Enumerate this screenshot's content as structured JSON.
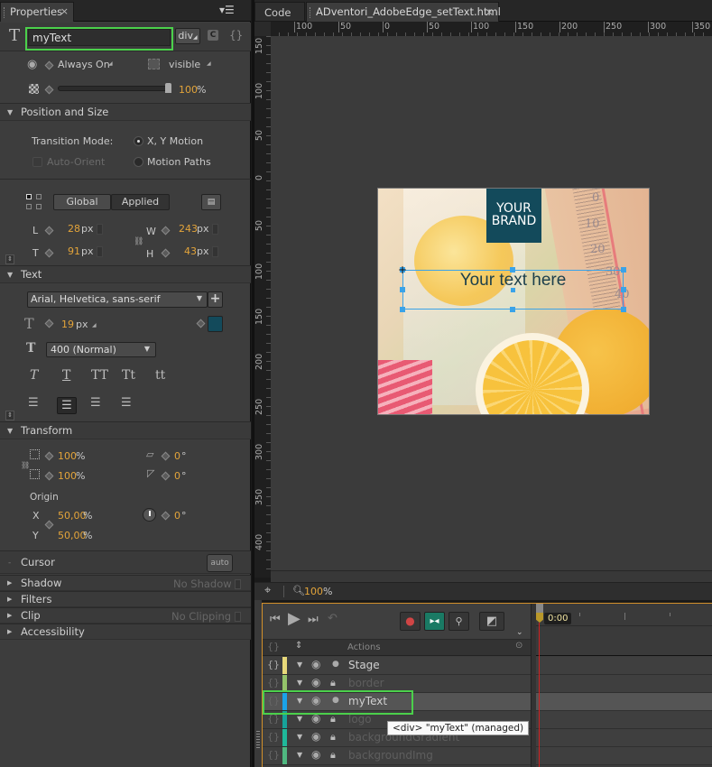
{
  "properties_panel": {
    "tab_label": "Properties",
    "element_name": "myText",
    "tag": "div",
    "display_mode": "Always On",
    "visibility": "visible",
    "opacity_value": "100",
    "opacity_unit": "%",
    "opacity_fraction": 1.0,
    "position_size": {
      "header": "Position and Size",
      "transition_mode_label": "Transition Mode:",
      "option_xy": "X, Y Motion",
      "option_paths": "Motion Paths",
      "auto_orient": "Auto-Orient",
      "global_label": "Global",
      "applied_label": "Applied",
      "L_label": "L",
      "L_value": "28",
      "L_unit": "px",
      "T_label": "T",
      "T_value": "91",
      "T_unit": "px",
      "W_label": "W",
      "W_value": "243",
      "W_unit": "px",
      "H_label": "H",
      "H_value": "43",
      "H_unit": "px"
    },
    "text": {
      "header": "Text",
      "font_family": "Arial, Helvetica, sans-serif",
      "font_size": "19",
      "font_size_unit": "px",
      "font_color": "#134a5b",
      "font_weight": "400 (Normal)",
      "style_buttons": [
        "T",
        "T",
        "TT",
        "Tt",
        "tt"
      ]
    },
    "transform": {
      "header": "Transform",
      "scale_x": "100",
      "scale_x_unit": "%",
      "scale_y": "100",
      "scale_y_unit": "%",
      "skew_x": "0",
      "skew_y": "0",
      "deg": "°",
      "origin_label": "Origin",
      "origin_x_label": "X",
      "origin_x": "50,00",
      "origin_x_unit": "%",
      "origin_y_label": "Y",
      "origin_y": "50,00",
      "origin_y_unit": "%",
      "rotation": "0"
    },
    "cursor": {
      "label": "Cursor",
      "value": "auto"
    },
    "shadow": {
      "label": "Shadow",
      "value": "No Shadow"
    },
    "filters": {
      "label": "Filters"
    },
    "clip": {
      "label": "Clip",
      "value": "No Clipping"
    },
    "accessibility": {
      "label": "Accessibility"
    }
  },
  "editor": {
    "tabs": [
      {
        "label": "Code"
      },
      {
        "label": "ADventori_AdobeEdge_setText.html",
        "active": true
      }
    ],
    "h_ruler": [
      "100",
      "50",
      "0",
      "50",
      "100",
      "150",
      "200",
      "250",
      "300",
      "350"
    ],
    "v_ruler": [
      "150",
      "100",
      "50",
      "0",
      "50",
      "100",
      "150",
      "200",
      "250",
      "300",
      "350",
      "400"
    ],
    "zoom_value": "100",
    "zoom_unit": "%",
    "stage": {
      "brand_line1": "YOUR",
      "brand_line2": "BRAND",
      "brand_bg": "#134a5b",
      "text_content": "Your text here",
      "thermometer_numbers": [
        "0",
        "10",
        "20",
        "30",
        "40"
      ]
    }
  },
  "timeline": {
    "time": "0:00",
    "actions_label": "Actions",
    "layers": [
      {
        "name": "Stage",
        "color": "#e8d97a",
        "locked": false,
        "dim": false
      },
      {
        "name": "border",
        "color": "#94c36a",
        "locked": true,
        "dim": true
      },
      {
        "name": "myText",
        "color": "#1aa3e8",
        "locked": false,
        "dim": false,
        "selected": true
      },
      {
        "name": "logo",
        "color": "#16a39a",
        "locked": true,
        "dim": true
      },
      {
        "name": "backgroundGradient",
        "color": "#1fb89a",
        "locked": true,
        "dim": true
      },
      {
        "name": "backgroundImg",
        "color": "#4fb880",
        "locked": true,
        "dim": true
      }
    ],
    "tooltip": "<div> \"myText\" (managed)"
  }
}
